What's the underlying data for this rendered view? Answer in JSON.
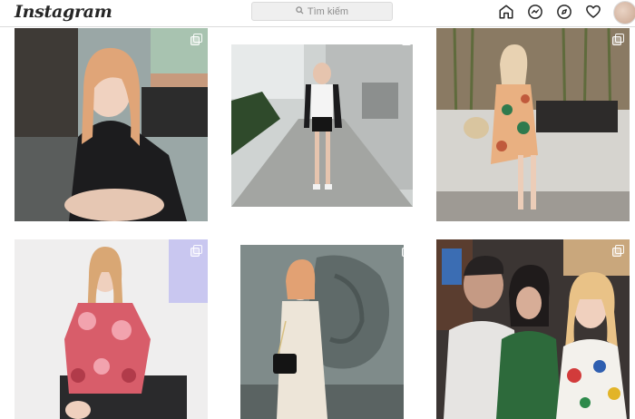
{
  "app": {
    "logo": "Instagram"
  },
  "search": {
    "placeholder": "Tìm kiếm"
  },
  "nav": {
    "icons": [
      "home-icon",
      "messenger-icon",
      "explore-icon",
      "heart-icon",
      "profile-avatar"
    ]
  },
  "colors": {
    "border": "#dbdbdb",
    "text": "#262626",
    "muted": "#8e8e8e",
    "search_bg": "#efefef"
  },
  "posts": [
    {
      "scene": "woman in black blazer sitting outdoors at cafe",
      "multi": true
    },
    {
      "scene": "woman in white top and black shorts on sidewalk",
      "multi": true
    },
    {
      "scene": "woman in floral dress sitting on stone bench by bamboo",
      "multi": true
    },
    {
      "scene": "woman in pink floral dress sitting on chair",
      "multi": true
    },
    {
      "scene": "woman in cream knit dress in front of carved wall",
      "multi": true
    },
    {
      "scene": "three people smiling selfie",
      "multi": true
    }
  ]
}
